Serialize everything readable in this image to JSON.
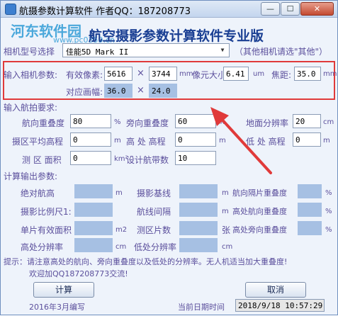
{
  "window": {
    "title": "航摄参数计算软件  作者QQ：187208773",
    "min_glyph": "—",
    "max_glyph": "☐",
    "close_glyph": "✕"
  },
  "watermark": {
    "main": "河东软件园",
    "sub": "www.pc0359.cn"
  },
  "heading": "航空摄影参数计算软件专业版",
  "camera": {
    "label": "相机型号选择",
    "selected": "佳能5D Mark II",
    "hint": "（其他相机请选\"其他\"）"
  },
  "input_params": {
    "section": "输入相机参数:",
    "effective_pixels_label": "有效像素:",
    "pixel_width": "5616",
    "times": "×",
    "pixel_height": "3744",
    "unit_mm": "mm",
    "pixel_size_label": "像元大小:",
    "pixel_size": "6.41",
    "unit_um": "um",
    "focal_label": "焦距:",
    "focal": "35.0",
    "unit_mm2": "mm",
    "frame_label": "对应画幅:",
    "frame_w": "36.0",
    "frame_h": "24.0"
  },
  "requirements": {
    "section": "输入航拍要求:",
    "forward_overlap_label": "航向重叠度",
    "forward_overlap": "80",
    "pct": "%",
    "side_overlap_label": "旁向重叠度",
    "side_overlap": "60",
    "gsd_label": "地面分辨率",
    "gsd": "20",
    "cm": "cm",
    "avg_elev_label": "摄区平均高程",
    "avg_elev": "0",
    "m": "m",
    "high_elev_label": "高 处 高程",
    "high_elev": "0",
    "low_elev_label": "低 处 高程",
    "low_elev": "0",
    "area_label": "测 区 面积",
    "area": "0",
    "km2": "km²",
    "strip_width_label": "设计航带数",
    "strip_width": "10"
  },
  "output": {
    "section": "计算输出参数:",
    "abs_height": "绝对航高",
    "base_line": "摄影基线",
    "side_overlap_at_strip": "航向隔片重叠度",
    "scale": "摄影比例尺1:",
    "strip_spacing": "航线间隔",
    "high_forward_overlap": "高处航向重叠度",
    "single_area": "单片有效面积",
    "photo_count": "测区片数",
    "high_side_overlap": "高处旁向重叠度",
    "high_gsd": "高处分辨率",
    "low_gsd": "低处分辨率",
    "m2": "m2",
    "zhang": "张"
  },
  "tip": {
    "line1": "提示：请注意高处的航向、旁向重叠度以及低处的分辨率。无人机适当加大重叠度!",
    "line2": "欢迎加QQ187208773交流!"
  },
  "buttons": {
    "calc": "计算",
    "cancel": "取消"
  },
  "footer": {
    "version": "2016年3月编写",
    "date_label": "当前日期时间",
    "datetime": "2018/9/18  10:57:29"
  },
  "colors": {
    "accent": "#e03a3a",
    "readonly": "#a6c0e3",
    "heading": "#1a3f93"
  }
}
